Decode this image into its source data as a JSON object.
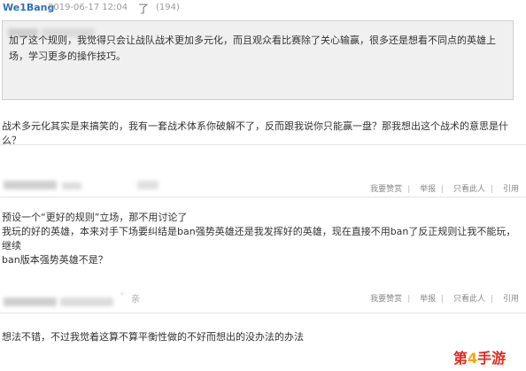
{
  "post": {
    "username": "We1Bang",
    "timestamp": "2019-06-17 12:04",
    "mark": "了",
    "count": "(194)"
  },
  "quote": {
    "text": "加了这个规则，我觉得只会让战队战术更加多元化，而且观众看比赛除了关心输赢，很多还是想看不同点的英雄上场，学习更多的操作技巧。"
  },
  "reply1": {
    "text": "战术多元化其实是来搞笑的，我有一套战术体系你破解不了，反而跟我说你只能赢一盘？那我想出这个战术的意思是什么？"
  },
  "comment2": {
    "actions": [
      "我要赞赏",
      "举报",
      "只看此人",
      "引用"
    ],
    "lines": [
      "预设一个“更好的规则”立场，那不用讨论了",
      "我玩的好的英雄，本来对手下场要纠结是ban强势英雄还是我发挥好的英雄，现在直接不用ban了反正规则让我不能玩，继续",
      "ban版本强势英雄不是？"
    ]
  },
  "comment3": {
    "actions": [
      "我要赞赏",
      "举报",
      "只看此人",
      "引用"
    ],
    "icon_char": "亲",
    "text": "想法不错，不过我觉着这算不算平衡性做的不好而想出的没办法的办法"
  },
  "watermark": {
    "prefix": "第",
    "num": "4",
    "suffix": "手游"
  }
}
